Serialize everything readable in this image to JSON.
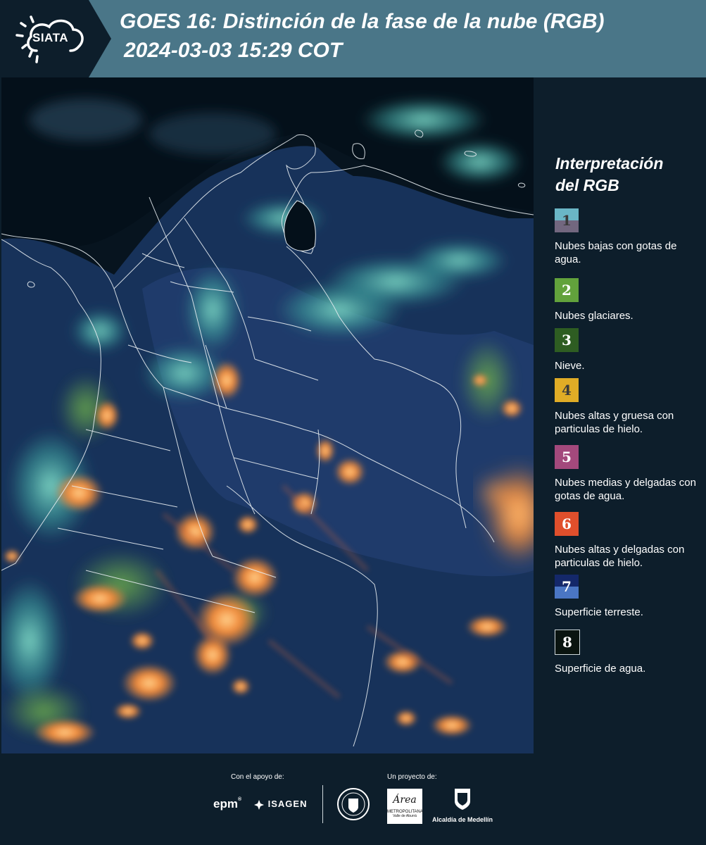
{
  "header": {
    "logo_text": "SIATA",
    "title_line1": "GOES 16: Distinción de la fase de la nube (RGB)",
    "title_line2": "2024-03-03 15:29 COT"
  },
  "legend": {
    "title_line1": "Interpretación",
    "title_line2": "del RGB",
    "items": [
      {
        "number": "1",
        "label": "Nubes bajas con gotas de agua.",
        "color_top": "#6ab6c6",
        "color_bottom": "#72677f",
        "number_color": "#3a3a3a"
      },
      {
        "number": "2",
        "label": "Nubes glaciares.",
        "color_top": "#62a23c",
        "color_bottom": "#62a23c",
        "number_color": "#ffffff"
      },
      {
        "number": "3",
        "label": "Nieve.",
        "color_top": "#2e5d22",
        "color_bottom": "#2e5d22",
        "number_color": "#ffffff"
      },
      {
        "number": "4",
        "label": "Nubes altas y gruesa con particulas de hielo.",
        "color_top": "#e0ac26",
        "color_bottom": "#e0ac26",
        "number_color": "#3a3a3a"
      },
      {
        "number": "5",
        "label": "Nubes medias y delgadas con gotas de agua.",
        "color_top": "#a3497c",
        "color_bottom": "#a3497c",
        "number_color": "#ffffff"
      },
      {
        "number": "6",
        "label": "Nubes altas y delgadas con particulas de hielo.",
        "color_top": "#e04f2c",
        "color_bottom": "#e04f2c",
        "number_color": "#ffffff"
      },
      {
        "number": "7",
        "label": "Superficie terreste.",
        "color_top": "#14286a",
        "color_bottom": "#4a76c4",
        "number_color": "#ffffff"
      },
      {
        "number": "8",
        "label": "Superficie de agua.",
        "color_top": "#0a1410",
        "color_bottom": "#0a1410",
        "number_color": "#ffffff"
      }
    ]
  },
  "footer": {
    "support_label": "Con el apoyo de:",
    "project_label": "Un proyecto de:",
    "sponsor1": "epm",
    "sponsor2": "ISAGEN",
    "partner1": "METROPOLITANA",
    "partner1_sub": "Valle de Aburrá",
    "partner1_name": "Área",
    "partner2": "Alcaldía de Medellín"
  },
  "colors": {
    "header_bg": "#4a7688",
    "page_bg": "#0d1e2b",
    "logo_bg": "#0d1e2b"
  }
}
